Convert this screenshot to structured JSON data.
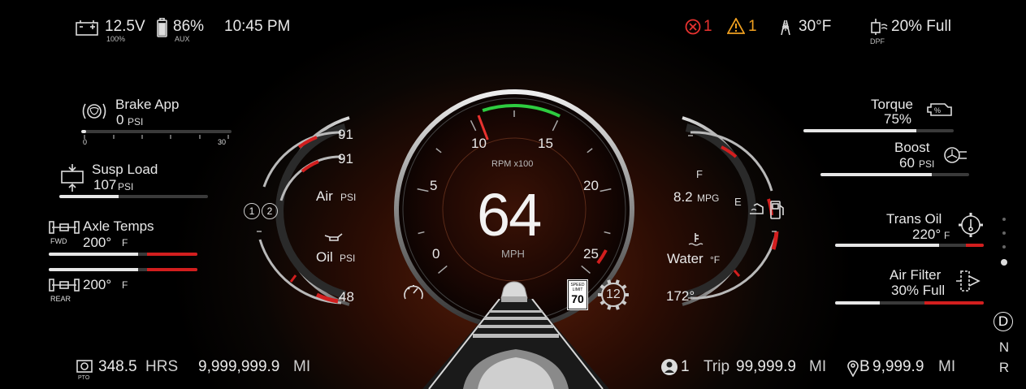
{
  "top_left": {
    "battery_voltage": "12.5V",
    "battery_sub": "100%",
    "aux_percent": "86%",
    "aux_sub": "AUX",
    "clock": "10:45 PM"
  },
  "top_right": {
    "fault_count": "1",
    "warning_count": "1",
    "outside_temp": "30°F",
    "dpf_status": "20% Full",
    "dpf_sub": "DPF"
  },
  "left_panel": {
    "brake": {
      "label": "Brake App",
      "value": "0",
      "unit": "PSI",
      "scale_min": "0",
      "scale_max": "30",
      "level": 0
    },
    "susp": {
      "label": "Susp Load",
      "value": "107",
      "unit": "PSI",
      "level": 0.4
    },
    "axle": {
      "label": "Axle Temps",
      "fwd_tag": "FWD",
      "rear_tag": "REAR",
      "fwd_value": "200°",
      "rear_value": "200°",
      "unit": "F",
      "fwd_level": 0.6,
      "rear_level": 0.6
    }
  },
  "left_gauge": {
    "air1_value": "91",
    "air2_value": "91",
    "air_label": "Air",
    "air_unit": "PSI",
    "oil_label": "Oil",
    "oil_unit": "PSI",
    "oil_value": "48",
    "circuit1": "1",
    "circuit2": "2"
  },
  "speedo": {
    "speed": "64",
    "speed_unit": "MPH",
    "rpm_label": "RPM x100",
    "rpm_ticks": [
      "0",
      "5",
      "10",
      "15",
      "20",
      "25"
    ],
    "rpm_value": 10.5,
    "gear": "12",
    "speed_limit_top": "SPEED LIMIT",
    "speed_limit": "70"
  },
  "right_gauge": {
    "mpg": "8.2",
    "mpg_unit": "MPG",
    "fuel_full": "F",
    "fuel_empty": "E",
    "water_label": "Water",
    "water_unit": "°F",
    "water_value": "172°"
  },
  "right_panel": {
    "torque": {
      "label": "Torque",
      "value": "75%",
      "level": 0.75
    },
    "boost": {
      "label": "Boost",
      "value": "60",
      "unit": "PSI",
      "level": 0.75
    },
    "trans": {
      "label": "Trans Oil",
      "value": "220°",
      "unit": "F",
      "level": 0.7
    },
    "air_filter": {
      "label": "Air Filter",
      "value": "30% Full",
      "level": 0.3
    }
  },
  "bottom_left": {
    "pto_tag": "PTO",
    "hours_value": "348.5",
    "hours_unit": "HRS",
    "odometer_value": "9,999,999.9",
    "odometer_unit": "MI"
  },
  "bottom_right": {
    "driver_id": "1",
    "trip_label": "Trip",
    "trip_value": "99,999.9",
    "trip_unit": "MI",
    "trip_b_label": "B",
    "trip_b_value": "9,999.9",
    "trip_b_unit": "MI"
  },
  "prnd": {
    "d": "D",
    "n": "N",
    "r": "R",
    "selected": "D"
  },
  "colors": {
    "accent_red": "#e8322f",
    "warning_amber": "#f0a020",
    "rpm_green": "#2ecc40"
  }
}
